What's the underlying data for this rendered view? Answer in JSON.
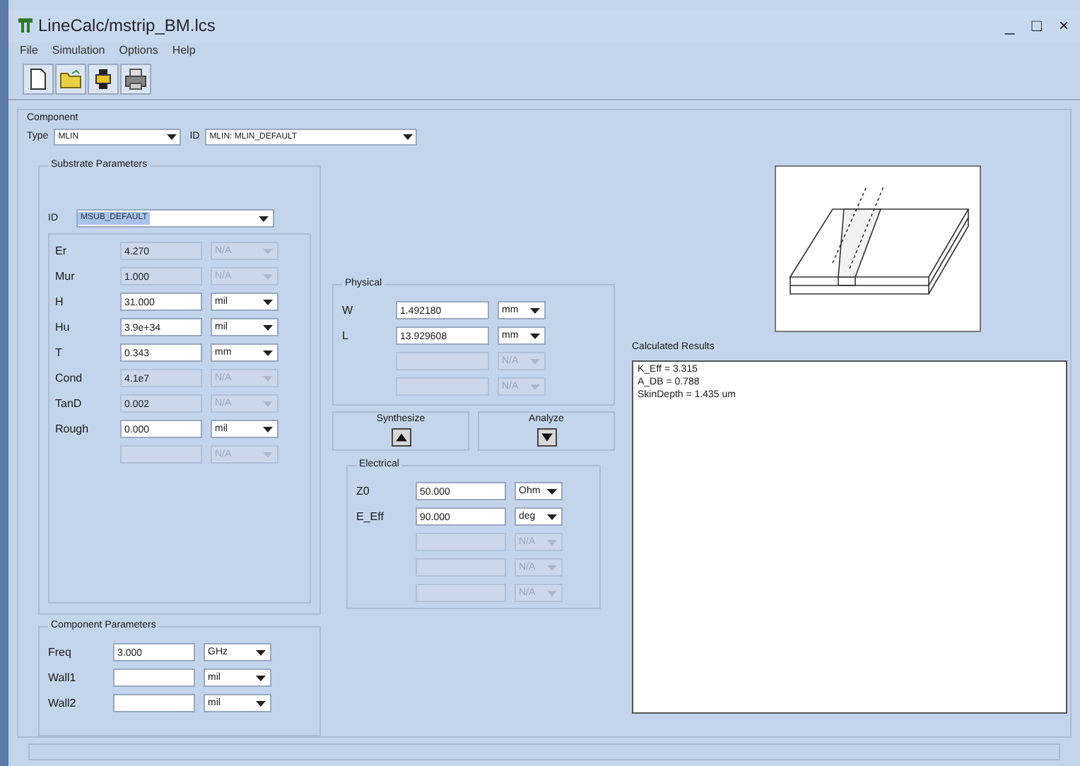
{
  "window": {
    "title": "LineCalc/mstrip_BM.lcs",
    "controls": [
      "_",
      "□",
      "×"
    ]
  },
  "menu": [
    "File",
    "Simulation",
    "Options",
    "Help"
  ],
  "toolbar": [
    {
      "kind": "new"
    },
    {
      "kind": "open"
    },
    {
      "kind": "tool"
    },
    {
      "kind": "print"
    }
  ],
  "component": {
    "title": "Component",
    "type_label": "Type",
    "type_value": "MLIN",
    "id_label": "ID",
    "id_value": "MLIN: MLIN_DEFAULT"
  },
  "substrate": {
    "title": "Substrate Parameters",
    "id_label": "ID",
    "id_value": "MSUB_DEFAULT",
    "rows": [
      {
        "label": "Er",
        "value": "4.270",
        "unit": "N/A",
        "disabled": true
      },
      {
        "label": "Mur",
        "value": "1.000",
        "unit": "N/A",
        "disabled": true
      },
      {
        "label": "H",
        "value": "31.000",
        "unit": "mil",
        "disabled": false
      },
      {
        "label": "Hu",
        "value": "3.9e+34",
        "unit": "mil",
        "disabled": false
      },
      {
        "label": "T",
        "value": "0.343",
        "unit": "mm",
        "disabled": false
      },
      {
        "label": "Cond",
        "value": "4.1e7",
        "unit": "N/A",
        "disabled": true
      },
      {
        "label": "TanD",
        "value": "0.002",
        "unit": "N/A",
        "disabled": true
      },
      {
        "label": "Rough",
        "value": "0.000",
        "unit": "mil",
        "disabled": false
      },
      {
        "unit": "N/A",
        "disabled": true
      }
    ]
  },
  "component_parameters": {
    "title": "Component Parameters",
    "rows": [
      {
        "label": "Freq",
        "value": "3.000",
        "unit": "GHz",
        "disabled": false
      },
      {
        "label": "Wall1",
        "unit": "mil",
        "disabled": false
      },
      {
        "label": "Wall2",
        "unit": "mil",
        "disabled": false
      }
    ]
  },
  "physical": {
    "title": "Physical",
    "rows": [
      {
        "label": "W",
        "value": "1.492180",
        "unit": "mm",
        "disabled": false
      },
      {
        "label": "L",
        "value": "13.929608",
        "unit": "mm",
        "disabled": false
      },
      {
        "unit": "N/A",
        "disabled": true
      },
      {
        "unit": "N/A",
        "disabled": true
      }
    ]
  },
  "synthesize": {
    "label": "Synthesize"
  },
  "analyze": {
    "label": "Analyze"
  },
  "electrical": {
    "title": "Electrical",
    "rows": [
      {
        "label": "Z0",
        "value": "50.000",
        "unit": "Ohm",
        "disabled": false
      },
      {
        "label": "E_Eff",
        "value": "90.000",
        "unit": "deg",
        "disabled": false
      },
      {
        "unit": "N/A",
        "disabled": true
      },
      {
        "unit": "N/A",
        "disabled": true
      },
      {
        "unit": "N/A",
        "disabled": true
      }
    ]
  },
  "results": {
    "title": "Calculated Results",
    "lines": [
      "K_Eff = 3.315",
      "A_DB = 0.788",
      "SkinDepth = 1.435 um"
    ]
  }
}
